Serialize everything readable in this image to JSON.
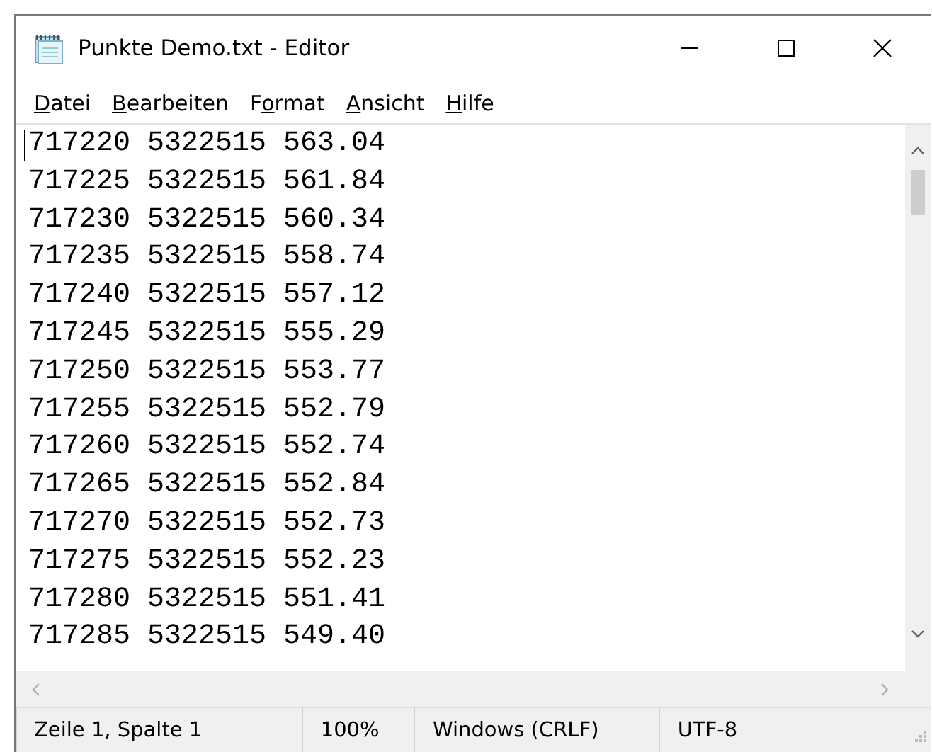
{
  "window": {
    "title": "Punkte Demo.txt - Editor"
  },
  "menu": [
    {
      "key": "D",
      "after": "atei"
    },
    {
      "key": "B",
      "after": "earbeiten"
    },
    {
      "before": "F",
      "key": "o",
      "after": "rmat"
    },
    {
      "key": "A",
      "after": "nsicht"
    },
    {
      "key": "H",
      "after": "ilfe"
    }
  ],
  "lines": [
    "717220 5322515 563.04",
    "717225 5322515 561.84",
    "717230 5322515 560.34",
    "717235 5322515 558.74",
    "717240 5322515 557.12",
    "717245 5322515 555.29",
    "717250 5322515 553.77",
    "717255 5322515 552.79",
    "717260 5322515 552.74",
    "717265 5322515 552.84",
    "717270 5322515 552.73",
    "717275 5322515 552.23",
    "717280 5322515 551.41",
    "717285 5322515 549.40"
  ],
  "status_bar": [
    "Zeile 1, Spalte 1",
    "100%",
    "Windows (CRLF)",
    "UTF-8"
  ]
}
